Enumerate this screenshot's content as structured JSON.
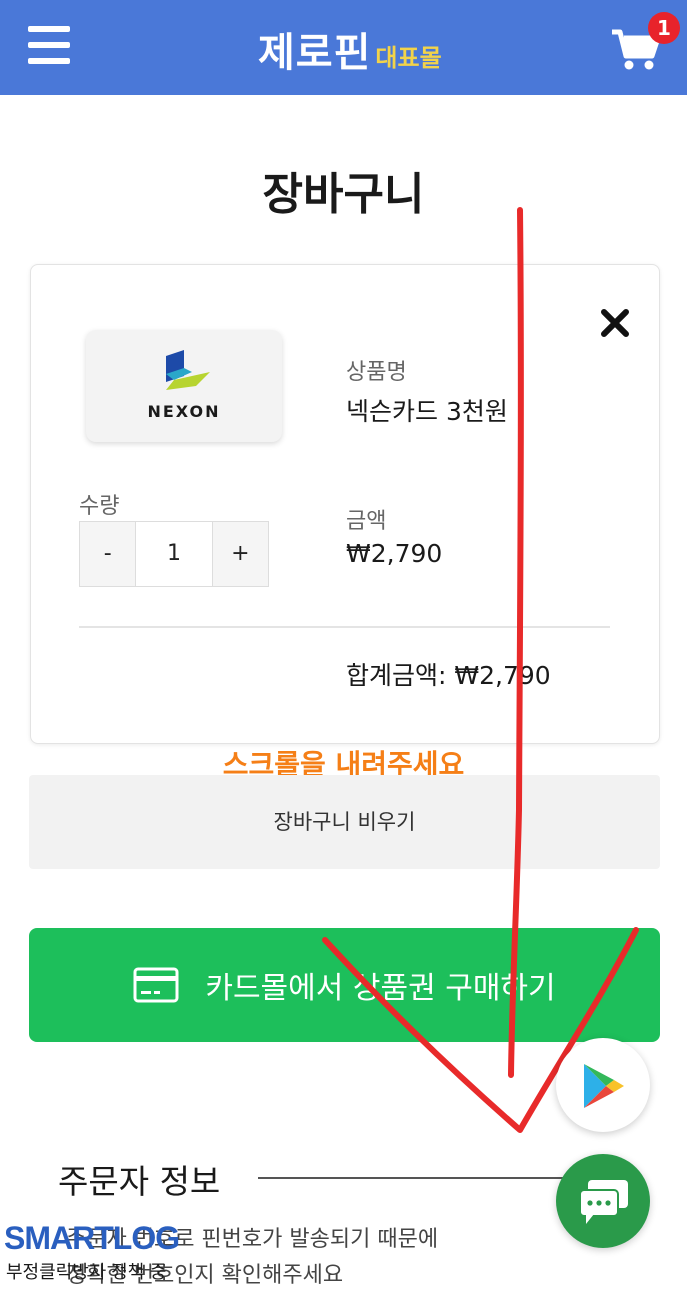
{
  "header": {
    "brand_main": "제로핀",
    "brand_sub": "대표몰",
    "cart_count": "1",
    "colors": {
      "bar": "#4a78d8",
      "brand_sub": "#f2d34a",
      "badge": "#e8232b"
    }
  },
  "page": {
    "title": "장바구니"
  },
  "cart_item": {
    "image_brand": "NEXON",
    "product_name_label": "상품명",
    "product_name": "넥슨카드 3천원",
    "quantity_label": "수량",
    "quantity_minus": "-",
    "quantity_value": "1",
    "quantity_plus": "+",
    "amount_label": "금액",
    "amount_value": "₩2,790",
    "total": "합계금액: ₩2,790"
  },
  "annotation": {
    "scroll_note": "스크롤을 내려주세요",
    "arrow_color": "#e82a2a"
  },
  "actions": {
    "empty_cart": "장바구니 비우기",
    "buy_with_cardmall": "카드몰에서 상품권 구매하기",
    "buy_color": "#1dbf5b"
  },
  "orderer": {
    "section_title": "주문자 정보",
    "notice_line1": "주문자 번호로 핀번호가 발송되기 때문에",
    "notice_line2": "정확한 번호인지 확인해주세요"
  },
  "watermark": {
    "logo": "SMARTLOG",
    "caption": "부정클릭방지 정책 중"
  },
  "icons": [
    "menu-icon",
    "cart-icon",
    "close-icon",
    "credit-card-icon",
    "play-store-icon",
    "chat-icon"
  ]
}
